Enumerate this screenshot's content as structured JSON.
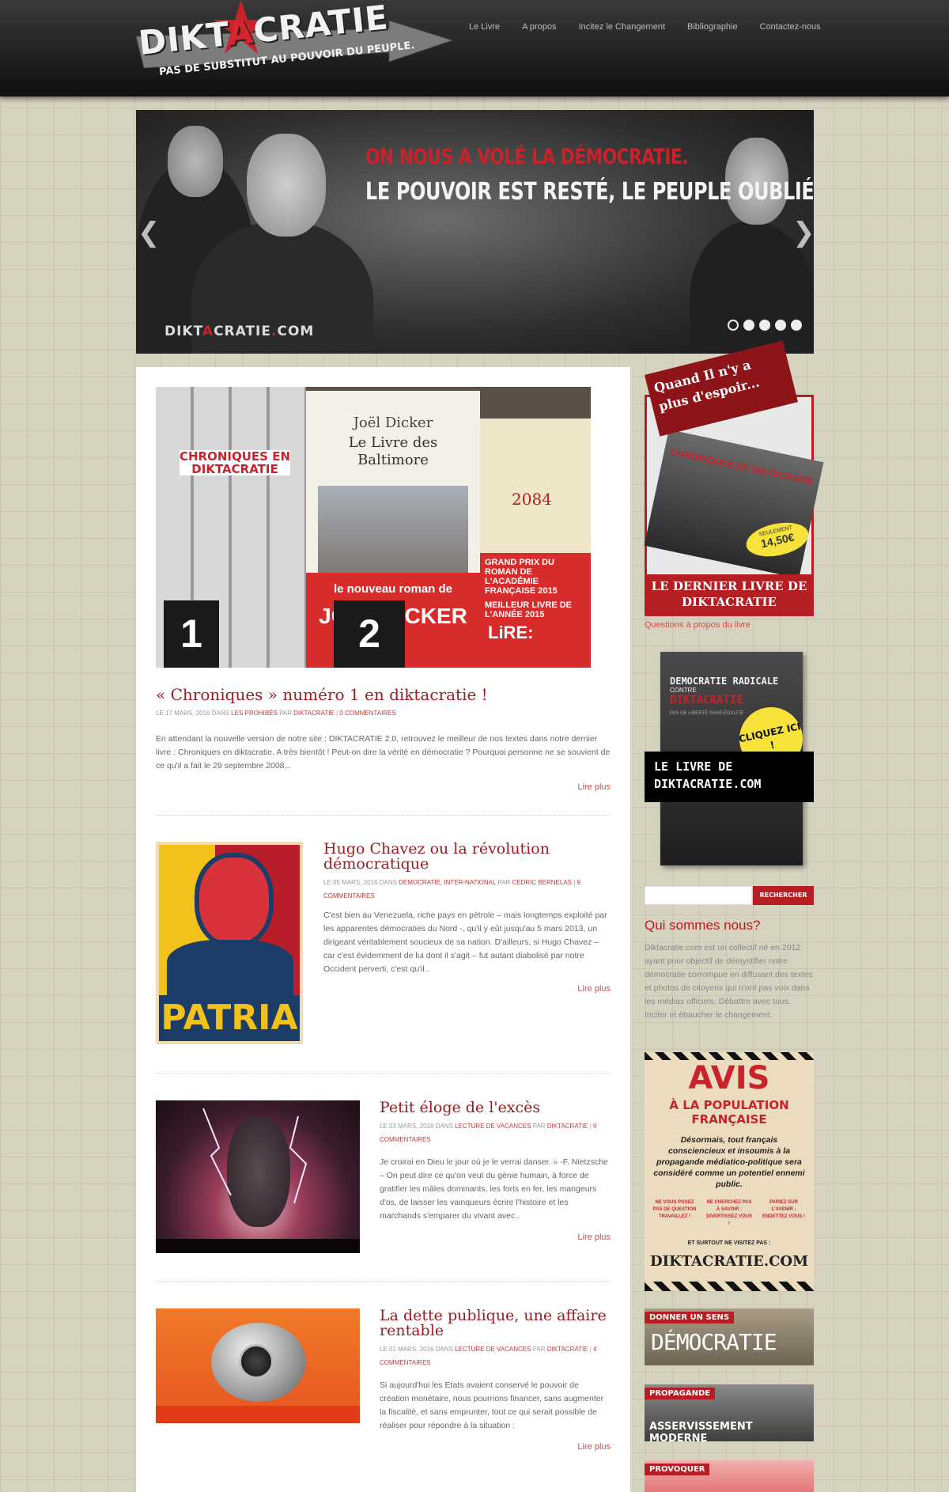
{
  "header": {
    "logo_word_pre": "DIKT",
    "logo_word_red": "A",
    "logo_word_post": "CRATIE",
    "tagline": "PAS DE SUBSTITUT AU POUVOIR DU PEUPLE.",
    "nav": [
      "Le Livre",
      "A propos",
      "Incitez le Changement",
      "Bibliographie",
      "Contactez-nous"
    ]
  },
  "slider": {
    "line1": "ON NOUS A VOLÉ LA DÉMOCRATIE.",
    "line2": "LE POUVOIR EST RESTÉ, LE PEUPLE OUBLIÉ.",
    "brand_pre": "DIKT",
    "brand_red": "A",
    "brand_mid": "CRATIE",
    "brand_dot": ".",
    "brand_post": "COM",
    "prev_arrow": "❮",
    "next_arrow": "❯",
    "slide_count": 5,
    "active_slide": 1
  },
  "posts": [
    {
      "title": "« Chroniques » numéro 1 en diktacratie !",
      "meta_date": "LE 17 MARS, 2016 DANS ",
      "meta_cats": "LES PROHIBÉS",
      "meta_by": " PAR ",
      "meta_author": "DIKTACRATIE",
      "meta_sep": " | ",
      "meta_comments": "0 COMMENTAIRES",
      "excerpt": "En attendant la nouvelle version de notre site : DIKTACRATIE 2.0, retrouvez le meilleur de nos textes dans notre dernier livre : Chroniques en diktacratie. A très bientôt ! Peut-on dire la vérité en démocratie ? Pourquoi personne ne se souvient de ce qu'il a fait le 29 septembre 2008,..",
      "read_more": "Lire plus",
      "image_labels": {
        "book_author": "Joël Dicker",
        "book_title": "Le Livre des Baltimore",
        "book2_title": "2084",
        "banner": "le nouveau roman de",
        "banner_name": "JOËL DICKER",
        "prize": "GRAND PRIX DU ROMAN DE L'ACADÉMIE FRANÇAISE 2015",
        "prize2": "MEILLEUR LIVRE DE L'ANNÉE 2015",
        "lire": "LiRE:",
        "chroniques": "CHRONIQUES EN DIKTACRATIE",
        "num1": "1",
        "num2": "2"
      }
    },
    {
      "title": "Hugo Chavez ou la révolution démocratique",
      "meta_date": "LE 05 MARS, 2016 DANS ",
      "meta_cats": "DEMOCRATIE, INTER-NATIONAL",
      "meta_by": " PAR ",
      "meta_author": "CEDRIC BERNELAS",
      "meta_sep": " | ",
      "meta_comments": "9 COMMENTAIRES",
      "excerpt": "C'est bien au Venezuela, riche pays en pétrole – mais longtemps exploité par les apparentes démocraties du Nord -, qu'il y eût jusqu'au 5 mars 2013, un dirigeant véritablement soucieux de sa nation. D'ailleurs, si Hugo Chavez – car c'est évidemment de lui dont il s'agit – fut autant diabolisé par notre Occident perverti, c'est qu'il..",
      "read_more": "Lire plus",
      "image_labels": {
        "poster_word": "PATRIA"
      }
    },
    {
      "title": "Petit éloge de l'excès",
      "meta_date": "LE 03 MARS, 2016 DANS ",
      "meta_cats": "LECTURE DE VACANCES",
      "meta_by": " PAR ",
      "meta_author": "DIKTACRATIE",
      "meta_sep": " | ",
      "meta_comments": "6 COMMENTAIRES",
      "excerpt": "Je croirai en Dieu le jour où je le verrai danser. »    -F. Nietzsche – On peut dire ce qu'on veut du génie humain, à force de gratifier les mâles dominants, les forts en fer, les mangeurs d'os, de laisser les vainqueurs écrire l'histoire et les marchands s'emparer du vivant avec..",
      "read_more": "Lire plus"
    },
    {
      "title": "La dette publique, une affaire rentable",
      "meta_date": "LE 01 MARS, 2016 DANS ",
      "meta_cats": "LECTURE DE VACANCES",
      "meta_by": " PAR ",
      "meta_author": "DIKTACRATIE",
      "meta_sep": " | ",
      "meta_comments": "4 COMMENTAIRES",
      "excerpt": "Si aujourd'hui les Etats avaient conservé le pouvoir de création monétaire, nous pourrions financer, sans augmenter la fiscalité, et sans emprunter, tout ce qui serait possible de réaliser pour répondre à la situation :",
      "read_more": "Lire plus"
    }
  ],
  "sidebar": {
    "promo1": {
      "ribbon_line1": "Quand Il n'y a",
      "ribbon_line2": "plus d'espoir...",
      "book_title": "CHRONIQUES EN DIKTACRATIE",
      "price_label": "SEULEMENT",
      "price": "14,50€",
      "caption": "LE DERNIER LIVRE DE DIKTACRATIE",
      "link": "Questions à propos du livre"
    },
    "promo2": {
      "book_title_line1": "DEMOCRATIE RADICALE",
      "book_contre": "CONTRE",
      "book_title_red_pre": "DIKT",
      "book_title_red_a": "A",
      "book_title_red_post": "CRATIE",
      "book_subtitle": "PAS DE LIBERTÉ SANS ÉGALITÉ",
      "badge": "CLIQUEZ ICI !",
      "caption_line1": "LE LIVRE DE",
      "caption_line2": "DIKTACRATIE.COM"
    },
    "search": {
      "placeholder": "",
      "button": "RECHERCHER"
    },
    "about": {
      "title": "Qui sommes nous?",
      "text": "Diktacratie.com est un collectif né en 2012 ayant pour objectif de démystifier notre démocratie corrompue en diffusant des textes et photos de citoyens qui n'ont pas voix dans les médias officiels. Débattre avec tous. Inciter et ébaucher le changement."
    },
    "avis": {
      "title": "AVIS",
      "subtitle": "À LA POPULATION FRANÇAISE",
      "body": "Désormais, tout français consciencieux et insoumis à la propagande médiatico-politique sera considéré comme un potentiel ennemi public.",
      "col1": "NE VOUS POSEZ PAS DE QUESTION TRAVAILLEZ !",
      "col2": "NE CHERCHEZ PAS À SAVOIR : DIVERTISSEZ VOUS !",
      "col3": "PARIEZ SUR L'AVENIR : ENDETTEZ VOUS !",
      "note": "ET SURTOUT NE VISITEZ PAS :",
      "site": "DIKTACRATIE.COM"
    },
    "banners": [
      {
        "tag": "DONNER UN SENS",
        "word": "DÉMOCRATIE"
      },
      {
        "tag": "PROPAGANDE",
        "word": "ASSERVISSEMENT MODERNE"
      },
      {
        "tag": "PROVOQUER",
        "word": ""
      }
    ]
  }
}
